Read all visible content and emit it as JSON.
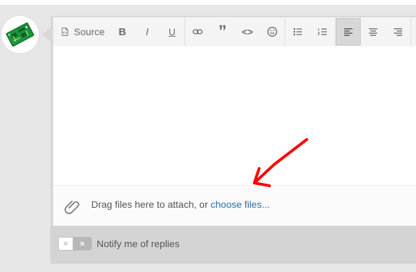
{
  "toolbar": {
    "source_label": "Source"
  },
  "attachments": {
    "prefix": "Drag files here to attach, or ",
    "link": "choose files...",
    "icon": "paperclip-icon"
  },
  "notify": {
    "label": "Notify me of replies",
    "toggle_state": "off"
  },
  "colors": {
    "link": "#2e6da4",
    "toolbar_bg": "#f4f4f4",
    "page_bg": "#e6e6e6",
    "annotation_arrow": "#ff0000"
  }
}
